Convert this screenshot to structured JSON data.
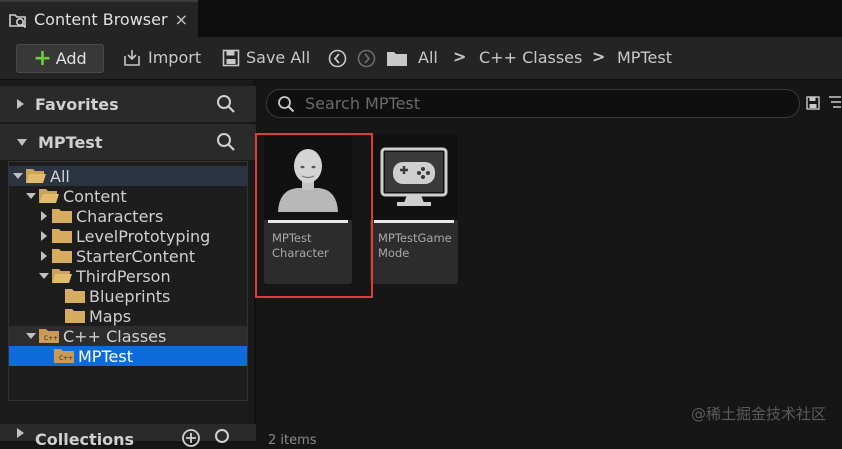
{
  "tab": {
    "title": "Content Browser",
    "close": "×"
  },
  "toolbar": {
    "add_label": "Add",
    "import_label": "Import",
    "save_all_label": "Save All",
    "breadcrumbs": [
      "All",
      "C++ Classes",
      "MPTest"
    ],
    "crumb_sep": ">"
  },
  "left": {
    "favorites": "Favorites",
    "project": "MPTest",
    "collections": "Collections",
    "tree": [
      "All",
      "Content",
      "Characters",
      "LevelPrototyping",
      "StarterContent",
      "ThirdPerson",
      "Blueprints",
      "Maps",
      "C++ Classes",
      "MPTest"
    ]
  },
  "search": {
    "placeholder": "Search MPTest"
  },
  "assets": [
    {
      "name": "MPTest\nCharacter"
    },
    {
      "name": "MPTestGame\nMode"
    }
  ],
  "watermark": "@稀土掘金技术社区",
  "bottom_text": "2 items",
  "colors": {
    "accent": "#0d6cd9",
    "add_plus": "#6fcc3c",
    "highlight": "#e03c3c"
  }
}
